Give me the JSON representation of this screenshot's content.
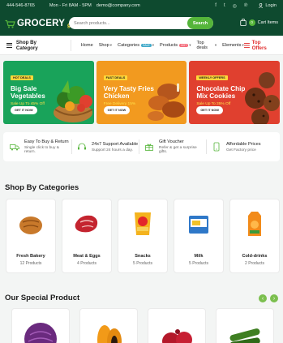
{
  "topbar": {
    "phone": "444-546-8765",
    "hours": "Mon - Fri 8AM - 5PM",
    "email": "demo@company.com",
    "login": "Login"
  },
  "header": {
    "logo_text": "GROCERY",
    "logo_sub": "go",
    "search_placeholder": "Search products...",
    "search_button": "Search",
    "cart_count": "0",
    "cart_label": "Cart Items"
  },
  "nav": {
    "shop_by_category": "Shop By Category",
    "items": [
      {
        "label": "Home"
      },
      {
        "label": "Shop"
      },
      {
        "label": "Categories",
        "tag": "SALE"
      },
      {
        "label": "Products",
        "tag": "HOT"
      },
      {
        "label": "Top deals"
      },
      {
        "label": "Elements"
      }
    ],
    "top_offers": "Top Offers"
  },
  "banners": [
    {
      "badge": "HOT DEALS",
      "title": "Big Sale Vegetables",
      "sub": "Sale Up To 45% Off",
      "button": "GET IT NOW"
    },
    {
      "badge": "FAST DEALS",
      "title": "Very Tasty Fries Chicken",
      "sub": "Free Delivery 15%",
      "button": "GET IT NOW"
    },
    {
      "badge": "WEEKLY OFFERS",
      "title": "Chocolate Chip Mix Cookies",
      "sub": "Sale Up To 35% Off",
      "button": "GET IT NOW"
    }
  ],
  "features": [
    {
      "title": "Easy To Buy & Return",
      "sub": "Single click to buy & return."
    },
    {
      "title": "24x7 Support Available",
      "sub": "Support 24 hours a day."
    },
    {
      "title": "Gift Voucher",
      "sub": "Refer & get a surprise gifts."
    },
    {
      "title": "Affordable Prices",
      "sub": "Get Factory price"
    }
  ],
  "categories_title": "Shop By Categories",
  "categories": [
    {
      "name": "Fresh Bakery",
      "count": "12 Products"
    },
    {
      "name": "Meat & Eggs",
      "count": "4 Products"
    },
    {
      "name": "Snacks",
      "count": "5 Products"
    },
    {
      "name": "Milk",
      "count": "5 Products"
    },
    {
      "name": "Cold-drinks",
      "count": "2 Products"
    }
  ],
  "special_title": "Our Special Product",
  "colors": {
    "brand_green": "#0e4a2f",
    "accent_green": "#55b53a",
    "offer_red": "#e02b2b"
  }
}
